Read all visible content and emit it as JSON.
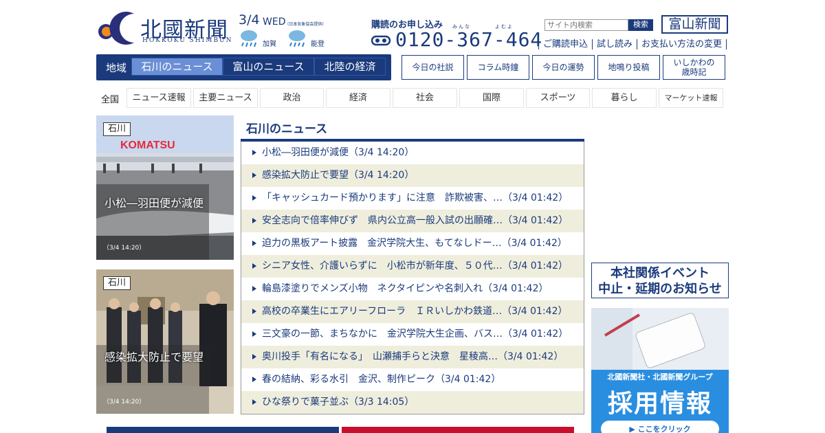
{
  "header": {
    "logo_name": "北國新聞",
    "logo_roman": "HOKKOKU SHIMBUN",
    "date": "3/4",
    "weekday": "WED",
    "jma_note": "(日本気象協会提供)",
    "weather": [
      {
        "area": "加賀",
        "icon": "rain-icon"
      },
      {
        "area": "能登",
        "icon": "rain-icon"
      }
    ],
    "subscribe_label": "購読のお申し込み",
    "ruby_1": "みんな",
    "ruby_2": "よむよ",
    "phone": "0120-367-464",
    "search_placeholder": "サイト内検索",
    "search_button": "検索",
    "toyama_logo": "富山新聞",
    "util_links": [
      "ご購読申込",
      "試し読み",
      "お支払い方法の変更"
    ]
  },
  "region_nav": {
    "label": "地域",
    "tabs": [
      "石川のニュース",
      "富山のニュース",
      "北陸の経済"
    ],
    "active": "石川のニュース"
  },
  "column_buttons": [
    "今日の社説",
    "コラム時鐘",
    "今日の運勢",
    "地鳴り投稿",
    "いしかわの\n歳時記"
  ],
  "categories": {
    "label": "全国",
    "items": [
      "ニュース速報",
      "主要ニュース",
      "政治",
      "経済",
      "社会",
      "国際",
      "スポーツ",
      "暮らし",
      "マーケット速報"
    ]
  },
  "cards": [
    {
      "tag": "石川",
      "caption": "小松―羽田便が減便",
      "time": "（3/4 14:20）",
      "sign": "KOMATSU"
    },
    {
      "tag": "石川",
      "caption": "感染拡大防止で要望",
      "time": "（3/4 14:20）"
    }
  ],
  "news": {
    "title": "石川のニュース",
    "items": [
      "小松―羽田便が減便（3/4 14:20）",
      "感染拡大防止で要望（3/4 14:20）",
      "「キャッシュカード預かります」に注意　詐欺被害、…（3/4 01:42）",
      "安全志向で倍率伸びず　県内公立高一般入試の出願確…（3/4 01:42）",
      "迫力の黒板アート披露　金沢学院大生、もてなしドー…（3/4 01:42）",
      "シニア女性、介護いらずに　小松市が新年度、５０代…（3/4 01:42）",
      "輪島漆塗りでメンズ小物　ネクタイピンや名刺入れ（3/4 01:42）",
      "高校の卒業生にエアリーフローラ　ＩＲいしかわ鉄道…（3/4 01:42）",
      "三文豪の一節、まちなかに　金沢学院大生企画、バス…（3/4 01:42）",
      "奥川投手「有名になる」　山瀬捕手らと決意　星稜高…（3/4 01:42）",
      "春の結納、彩る水引　金沢、制作ピーク（3/4 01:42）",
      "ひな祭りで菓子並ぶ（3/3 14:05）"
    ]
  },
  "sidebar": {
    "event_banner": [
      "本社関係イベント",
      "中止・延期のお知らせ"
    ],
    "recruit_group": "北國新聞社・北國新聞グループ",
    "recruit_title": "採用情報",
    "recruit_button": "▶ ここをクリック"
  },
  "colors": {
    "brand": "#1a3a7c",
    "accent": "#6b8fd6",
    "row_alt": "#efeedd"
  }
}
